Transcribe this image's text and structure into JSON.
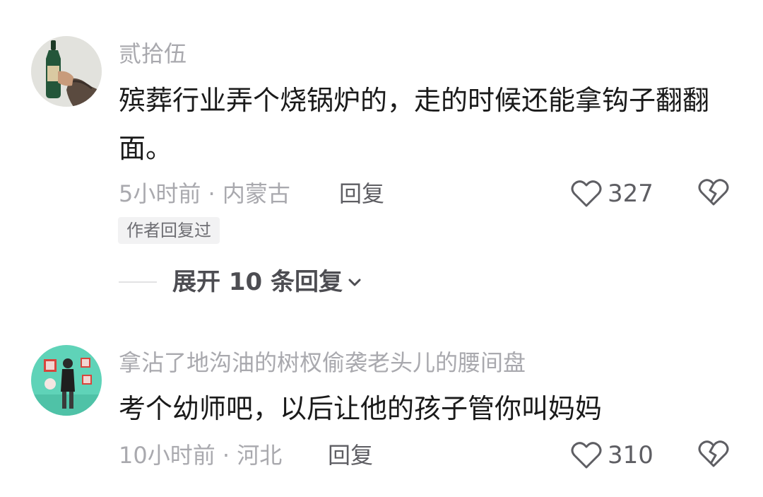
{
  "comments": [
    {
      "username": "贰拾伍",
      "avatar_icon": "avatar-hand-holding-bottle",
      "text": "殡葬行业弄个烧锅炉的，走的时候还能拿钩子翻翻面。",
      "meta": "5小时前 · 内蒙古",
      "reply_label": "回复",
      "like_count": "327",
      "badge": "作者回复过",
      "expand_label": "展开 10 条回复"
    },
    {
      "username": "拿沾了地沟油的树杈偷袭老头儿的腰间盘",
      "avatar_icon": "avatar-person-in-gallery",
      "text": "考个幼师吧，以后让他的孩子管你叫妈妈",
      "meta": "10小时前 · 河北",
      "reply_label": "回复",
      "like_count": "310"
    }
  ],
  "colors": {
    "username": "#a9a9ae",
    "text": "#1a1a1a",
    "meta": "#a9a9ae",
    "action": "#5e5e63",
    "avatar2_bg": "#5fd3b8"
  },
  "icons": [
    "heart-icon",
    "broken-heart-icon",
    "chevron-down-icon"
  ]
}
